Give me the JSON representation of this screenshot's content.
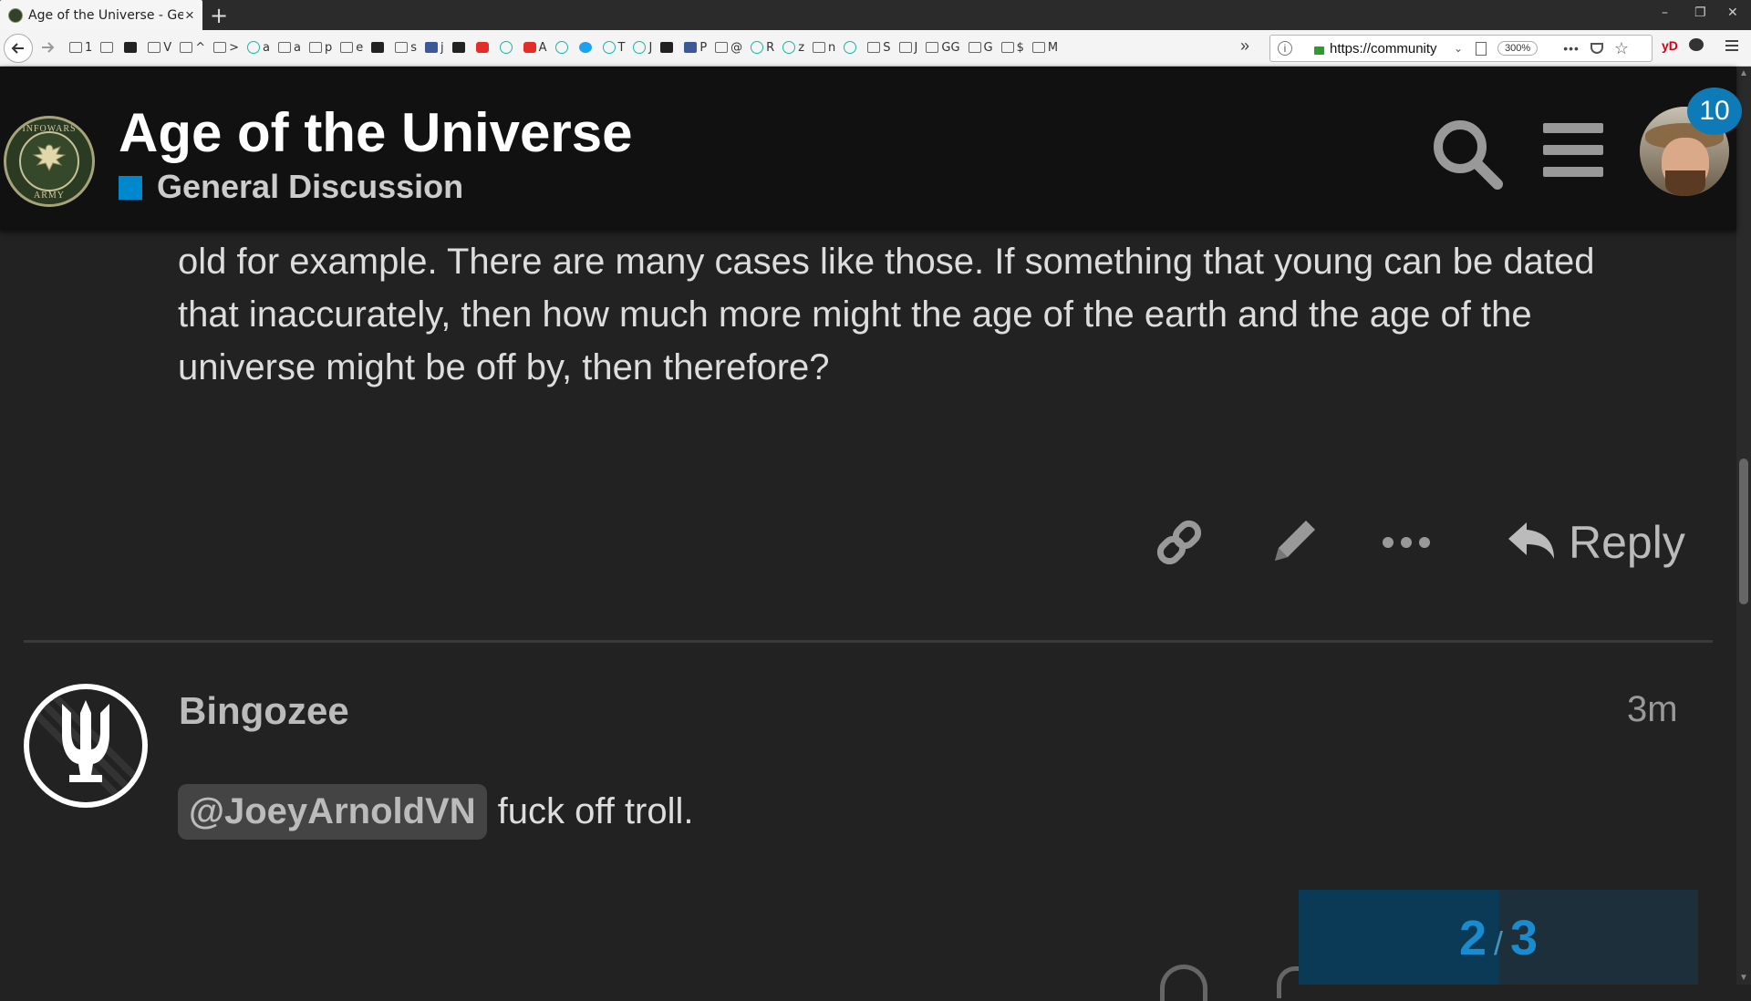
{
  "browser": {
    "tab_title": "Age of the Universe - General Discussion",
    "tab_close": "×",
    "new_tab": "+",
    "window_controls": [
      "–",
      "❐",
      "✕"
    ],
    "bookmarks": [
      {
        "icon": "folder-icon",
        "label": "1"
      },
      {
        "icon": "folder-icon",
        "label": ""
      },
      {
        "icon": "car-icon",
        "label": ""
      },
      {
        "icon": "folder-icon",
        "label": "V"
      },
      {
        "icon": "folder-icon",
        "label": "^"
      },
      {
        "icon": "folder-icon",
        "label": ">"
      },
      {
        "icon": "circle-icon",
        "label": "a"
      },
      {
        "icon": "folder-icon",
        "label": "a"
      },
      {
        "icon": "folder-icon",
        "label": "p"
      },
      {
        "icon": "folder-icon",
        "label": "e"
      },
      {
        "icon": "dark-icon",
        "label": ""
      },
      {
        "icon": "folder-icon",
        "label": "s"
      },
      {
        "icon": "facebook-icon",
        "label": "j"
      },
      {
        "icon": "dark-icon",
        "label": ""
      },
      {
        "icon": "youtube-icon",
        "label": ""
      },
      {
        "icon": "bulb-icon",
        "label": ""
      },
      {
        "icon": "youtube-icon",
        "label": "A"
      },
      {
        "icon": "circle-icon",
        "label": ""
      },
      {
        "icon": "twitter-icon",
        "label": ""
      },
      {
        "icon": "circle-icon",
        "label": "T"
      },
      {
        "icon": "circle-icon",
        "label": "J"
      },
      {
        "icon": "dark-icon",
        "label": ""
      },
      {
        "icon": "facebook-icon",
        "label": "P"
      },
      {
        "icon": "folder-icon",
        "label": "@"
      },
      {
        "icon": "circle-icon",
        "label": "R"
      },
      {
        "icon": "circle-icon",
        "label": "z"
      },
      {
        "icon": "folder-icon",
        "label": "n"
      },
      {
        "icon": "circle-icon",
        "label": ""
      },
      {
        "icon": "folder-icon",
        "label": "S"
      },
      {
        "icon": "folder-icon",
        "label": "J"
      },
      {
        "icon": "folder-icon",
        "label": "GG"
      },
      {
        "icon": "folder-icon",
        "label": "G"
      },
      {
        "icon": "folder-icon",
        "label": "$"
      },
      {
        "icon": "folder-icon",
        "label": "M"
      }
    ],
    "overflow": "»",
    "url": "https://community",
    "zoom": "300%",
    "more": "•••",
    "ext_yd": "yD"
  },
  "header": {
    "logo_top_text": "INFOWARS",
    "logo_bottom_text": "ARMY",
    "title": "Age of the Universe",
    "category": "General Discussion",
    "category_color": "#0088cc",
    "notification_count": "10"
  },
  "post1": {
    "text_lines": [
      "old for example. There are many cases like those. If something that young can be dated",
      "that inaccurately, then how much more might the age of the earth and the age of the",
      "universe might be off by, then therefore?"
    ],
    "reply_label": "Reply"
  },
  "post2": {
    "username": "Bingozee",
    "time": "3m",
    "mention": "@JoeyArnoldVN",
    "text": "fuck off troll."
  },
  "progress": {
    "current": "2",
    "separator": "/",
    "total": "3",
    "fraction": 0.5
  }
}
